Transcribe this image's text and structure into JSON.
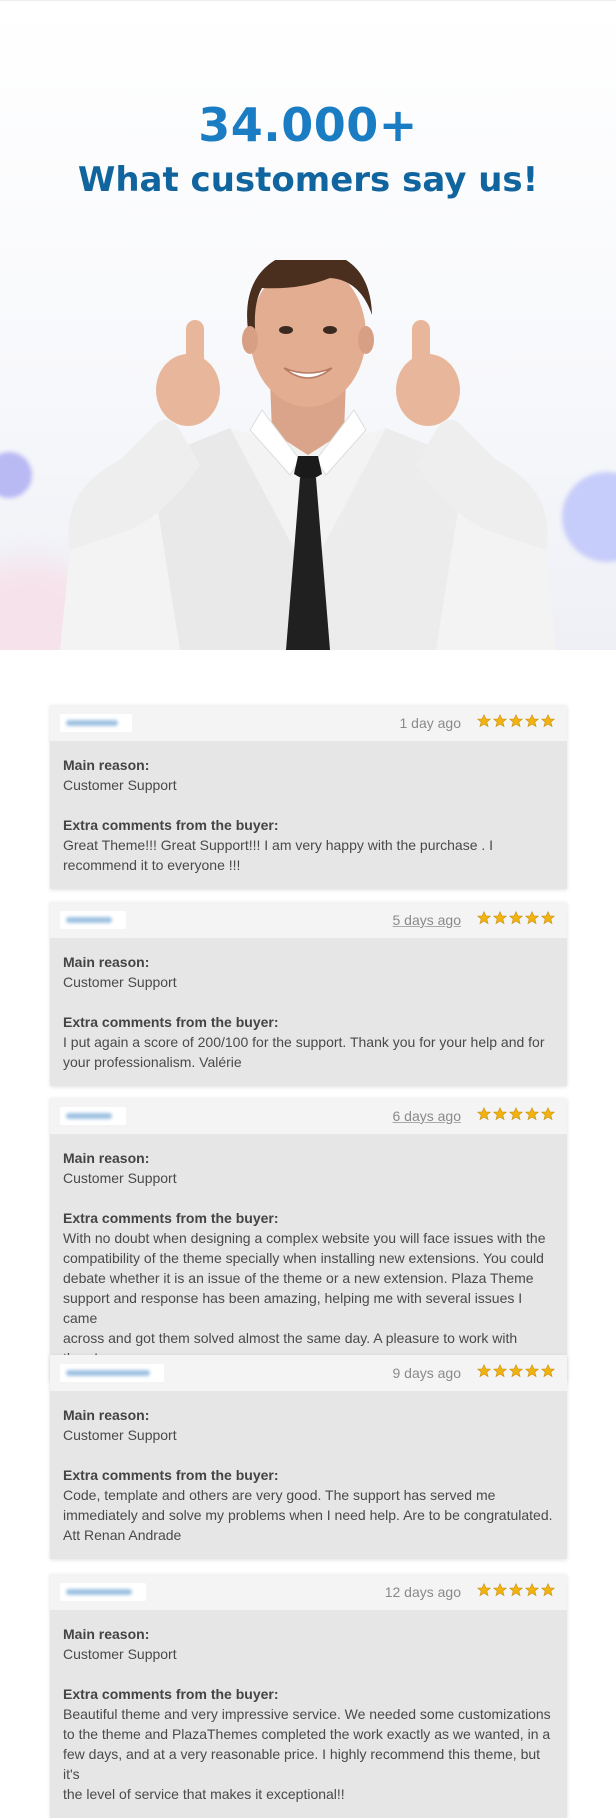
{
  "hero": {
    "count": "34.000+",
    "title": "What customers say us!"
  },
  "colors": {
    "headline": "#1a7dc4",
    "title": "#11659e",
    "star": "#f1b312",
    "card_bg": "#e6e6e6",
    "card_head_bg": "#f4f4f4"
  },
  "reviews": [
    {
      "date": "1 day ago",
      "rating": 5,
      "main_reason_label": "Main reason:",
      "main_reason": "Customer Support",
      "comments_label": "Extra comments from the buyer:",
      "comment_lines": [
        "Great Theme!!! Great Support!!! I am very happy with the purchase . I",
        "recommend it to everyone !!!"
      ]
    },
    {
      "date": "5 days ago",
      "rating": 5,
      "main_reason_label": "Main reason:",
      "main_reason": "Customer Support",
      "comments_label": "Extra comments from the buyer:",
      "comment_lines": [
        "I put again a score of 200/100 for the support. Thank you for your help and for",
        "your professionalism. Valérie"
      ]
    },
    {
      "date": "6 days ago",
      "rating": 5,
      "main_reason_label": "Main reason:",
      "main_reason": "Customer Support",
      "comments_label": "Extra comments from the buyer:",
      "comment_lines": [
        "With no doubt when designing a complex website you will face issues with the",
        "compatibility of the theme specially when installing new extensions. You could",
        "debate whether it is an issue of the theme or a new extension. Plaza Theme",
        "support and response has been amazing, helping me with several issues I came",
        "across and got them solved almost the same day. A pleasure to work with them!"
      ]
    },
    {
      "date": "9 days ago",
      "rating": 5,
      "main_reason_label": "Main reason:",
      "main_reason": "Customer Support",
      "comments_label": "Extra comments from the buyer:",
      "comment_lines": [
        "Code, template and others are very good. The support has served me",
        "immediately and solve my problems when I need help. Are to be congratulated.",
        "Att Renan Andrade"
      ]
    },
    {
      "date": "12 days ago",
      "rating": 5,
      "main_reason_label": "Main reason:",
      "main_reason": "Customer Support",
      "comments_label": "Extra comments from the buyer:",
      "comment_lines": [
        "Beautiful theme and very impressive service. We needed some customizations",
        "to the theme and PlazaThemes completed the work exactly as we wanted, in a",
        "few days, and at a very reasonable price. I highly recommend this theme, but it's",
        "the level of service that makes it exceptional!!"
      ]
    }
  ]
}
